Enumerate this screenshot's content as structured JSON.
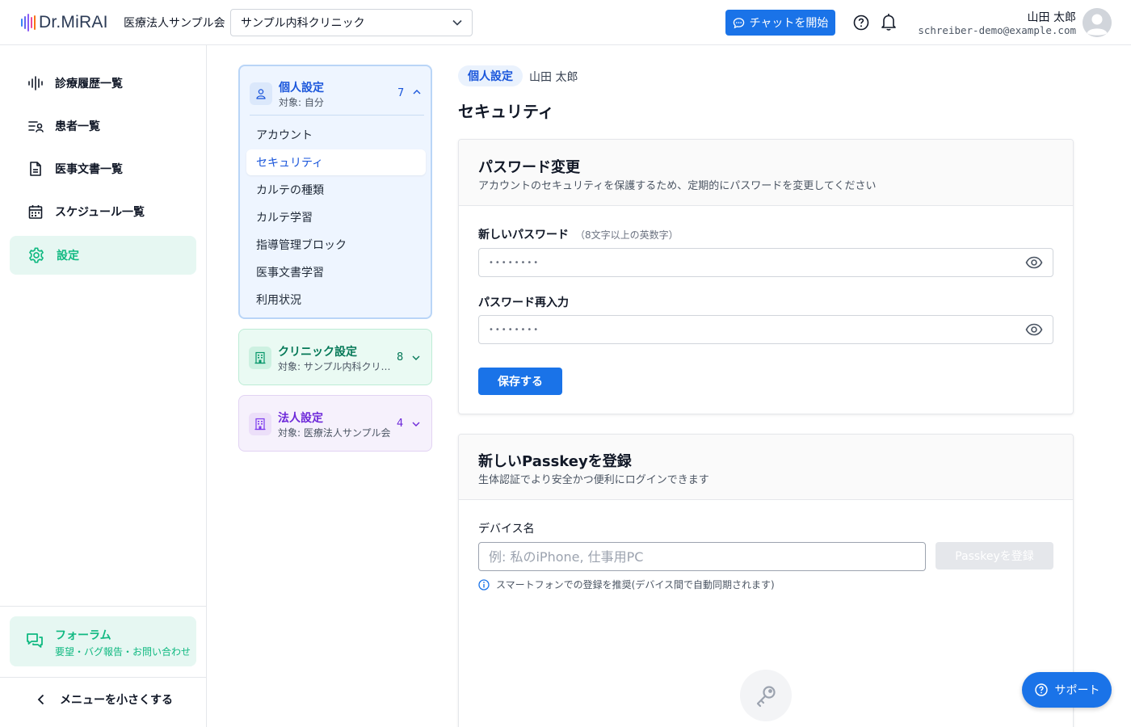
{
  "header": {
    "logo_text": "Dr.MiRAI",
    "org_name": "医療法人サンプル会",
    "clinic_selected": "サンプル内科クリニック",
    "chat_button": "チャットを開始",
    "user_name": "山田 太郎",
    "user_email": "schreiber-demo@example.com"
  },
  "sidebar": {
    "items": [
      {
        "label": "診療履歴一覧",
        "icon": "waveform-icon"
      },
      {
        "label": "患者一覧",
        "icon": "patient-list-icon"
      },
      {
        "label": "医事文書一覧",
        "icon": "document-icon"
      },
      {
        "label": "スケジュール一覧",
        "icon": "calendar-icon"
      },
      {
        "label": "設定",
        "icon": "gear-icon",
        "active": true
      }
    ],
    "forum_title": "フォーラム",
    "forum_sub": "要望・バグ報告・お問い合わせ",
    "collapse_label": "メニューを小さくする"
  },
  "settings_nav": {
    "personal": {
      "title": "個人設定",
      "target": "対象: 自分",
      "count": "7",
      "items": [
        "アカウント",
        "セキュリティ",
        "カルテの種類",
        "カルテ学習",
        "指導管理ブロック",
        "医事文書学習",
        "利用状況"
      ],
      "active_index": 1
    },
    "clinic": {
      "title": "クリニック設定",
      "target": "対象: サンプル内科クリニック",
      "count": "8"
    },
    "corp": {
      "title": "法人設定",
      "target": "対象: 医療法人サンプル会",
      "count": "4"
    }
  },
  "main": {
    "breadcrumb_badge": "個人設定",
    "breadcrumb_user": "山田 太郎",
    "page_title": "セキュリティ",
    "password": {
      "title": "パスワード変更",
      "desc": "アカウントのセキュリティを保護するため、定期的にパスワードを変更してください",
      "new_label": "新しいパスワード",
      "new_hint": "（8文字以上の英数字）",
      "new_value": "••••••••",
      "confirm_label": "パスワード再入力",
      "confirm_value": "••••••••",
      "save_button": "保存する"
    },
    "passkey": {
      "title": "新しいPasskeyを登録",
      "desc": "生体認証でより安全かつ便利にログインできます",
      "device_label": "デバイス名",
      "device_placeholder": "例: 私のiPhone, 仕事用PC",
      "register_button": "Passkeyを登録",
      "info": "スマートフォンでの登録を推奨(デバイス間で自動同期されます)"
    }
  },
  "support_button": "サポート",
  "colors": {
    "primary": "#1a73e8",
    "accent_green": "#10b981",
    "purple": "#7c3aed"
  }
}
